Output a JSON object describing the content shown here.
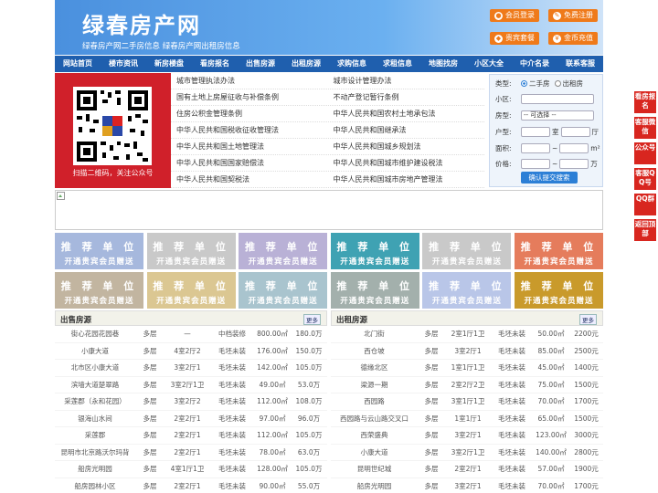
{
  "header": {
    "logo": "绿春房产网",
    "subtitle": "绿春房产网二手房信息    绿春房产网出租房信息",
    "buttons": [
      "会员登录",
      "免费注册",
      "贵宾套餐",
      "金币充值"
    ]
  },
  "nav": [
    "网站首页",
    "楼市资讯",
    "新房楼盘",
    "看房报名",
    "出售房源",
    "出租房源",
    "求购信息",
    "求租信息",
    "地图找房",
    "小区大全",
    "中介名录",
    "联系客服"
  ],
  "qr": {
    "caption": "扫描二维码，关注公众号"
  },
  "links": [
    [
      "城市管理执法办法",
      "城市设计管理办法"
    ],
    [
      "国有土地上房屋征收与补偿条例",
      "不动产登记暂行条例"
    ],
    [
      "住房公积金管理条例",
      "中华人民共和国农村土地承包法"
    ],
    [
      "中华人民共和国税收征收管理法",
      "中华人民共和国继承法"
    ],
    [
      "中华人民共和国土地管理法",
      "中华人民共和国城乡规划法"
    ],
    [
      "中华人民共和国国家赔偿法",
      "中华人民共和国城市维护建设税法"
    ],
    [
      "中华人民共和国契税法",
      "中华人民共和国城市房地产管理法"
    ]
  ],
  "search": {
    "type_label": "类型:",
    "opt1": "二手房",
    "opt2": "出租房",
    "community_label": "小区:",
    "house_label": "房型:",
    "house_select": "-- 可选择 --",
    "layout_label": "户型:",
    "room": "室",
    "hall": "厅",
    "area_label": "面积:",
    "area_sep": "~",
    "area_unit": "m²",
    "price_label": "价格:",
    "price_unit": "万",
    "submit": "确认提交搜索"
  },
  "promo": {
    "t1": "推 荐 单 位",
    "t2": "开通贵宾会员赠送"
  },
  "promo_colors": [
    "#a6b8dd",
    "#c9c9c9",
    "#b9b1d6",
    "#3fa2b3",
    "#c9c9c9",
    "#e57c5c",
    "#c2b5a0",
    "#dbc792",
    "#a9c4ce",
    "#a3b0ac",
    "#b9c6e8",
    "#c99a2b"
  ],
  "sale": {
    "title": "出售房源",
    "more": "更多",
    "rows": [
      [
        "街心花园花园巷",
        "多层",
        "—",
        "中档装修",
        "800.00㎡",
        "180.0万"
      ],
      [
        "小康大道",
        "多层",
        "4室2厅2",
        "毛坯未装",
        "176.00㎡",
        "150.0万"
      ],
      [
        "北市区小康大道",
        "多层",
        "3室2厅1",
        "毛坯未装",
        "142.00㎡",
        "105.0万"
      ],
      [
        "滨墙大道楚翠路",
        "多层",
        "3室2厅1卫",
        "毛坯未装",
        "49.00㎡",
        "53.0万"
      ],
      [
        "采莲郡（永和花园）",
        "多层",
        "3室2厅2",
        "毛坯未装",
        "112.00㎡",
        "108.0万"
      ],
      [
        "银海山水间",
        "多层",
        "2室2厅1",
        "毛坯未装",
        "97.00㎡",
        "96.0万"
      ],
      [
        "采莲郡",
        "多层",
        "2室2厅1",
        "毛坯未装",
        "112.00㎡",
        "105.0万"
      ],
      [
        "昆明市北京路沃尔玛背",
        "多层",
        "2室2厅1",
        "毛坯未装",
        "78.00㎡",
        "63.0万"
      ],
      [
        "船房光明园",
        "多层",
        "4室1厅1卫",
        "毛坯未装",
        "128.00㎡",
        "105.0万"
      ],
      [
        "船房园林小区",
        "多层",
        "2室2厅1",
        "毛坯未装",
        "90.00㎡",
        "55.0万"
      ]
    ]
  },
  "rent": {
    "title": "出租房源",
    "more": "更多",
    "rows": [
      [
        "北门街",
        "多层",
        "2室1厅1卫",
        "毛坯未装",
        "50.00㎡",
        "2200元"
      ],
      [
        "西仓坡",
        "多层",
        "3室2厅1",
        "毛坯未装",
        "85.00㎡",
        "2500元"
      ],
      [
        "德缘北区",
        "多层",
        "1室1厅1卫",
        "毛坯未装",
        "45.00㎡",
        "1400元"
      ],
      [
        "梁源一期",
        "多层",
        "2室2厅2卫",
        "毛坯未装",
        "75.00㎡",
        "1500元"
      ],
      [
        "西园路",
        "多层",
        "3室1厅1卫",
        "毛坯未装",
        "70.00㎡",
        "1700元"
      ],
      [
        "西园路与云山路交叉口",
        "多层",
        "1室1厅1",
        "毛坯未装",
        "65.00㎡",
        "1500元"
      ],
      [
        "西荣盛典",
        "多层",
        "3室2厅1",
        "毛坯未装",
        "123.00㎡",
        "3000元"
      ],
      [
        "小康大道",
        "多层",
        "3室2厅1卫",
        "毛坯未装",
        "140.00㎡",
        "2800元"
      ],
      [
        "昆明世纪城",
        "多层",
        "2室2厅1",
        "毛坯未装",
        "57.00㎡",
        "1900元"
      ],
      [
        "船房光明园",
        "多层",
        "3室2厅1",
        "毛坯未装",
        "70.00㎡",
        "1700元"
      ]
    ]
  },
  "side": [
    "看房报名",
    "客服微信",
    "公众号",
    "客服QQ号",
    "QQ群",
    "返回顶部"
  ]
}
